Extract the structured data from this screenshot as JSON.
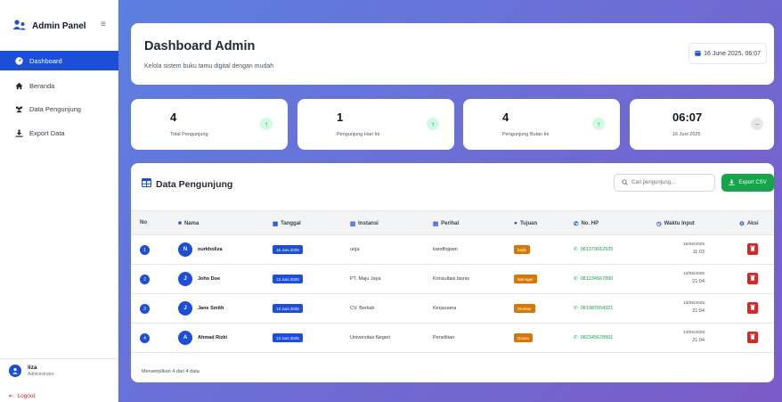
{
  "sidebar": {
    "brand": "Admin Panel",
    "items": [
      {
        "label": "Dashboard",
        "icon": "gauge-icon"
      },
      {
        "label": "Beranda",
        "icon": "home-icon"
      },
      {
        "label": "Data Pengunjung",
        "icon": "users-icon"
      },
      {
        "label": "Export Data",
        "icon": "download-icon"
      }
    ],
    "user": {
      "name": "liza",
      "role": "Administrator"
    },
    "logout_label": "Logout"
  },
  "header": {
    "title": "Dashboard Admin",
    "subtitle": "Kelola sistem buku tamu digital dengan mudah",
    "datetime": "16 June 2025, 06:07"
  },
  "stats": [
    {
      "value": "4",
      "label": "Total Pengunjung",
      "icon": "arrow-up-icon"
    },
    {
      "value": "1",
      "label": "Pengunjung Hari Ini",
      "icon": "arrow-up-icon"
    },
    {
      "value": "4",
      "label": "Pengunjung Bulan Ini",
      "icon": "arrow-up-icon"
    },
    {
      "value": "06:07",
      "label": "16 Juni 2025",
      "icon": "minus-icon"
    }
  ],
  "table": {
    "title": "Data Pengunjung",
    "search_placeholder": "Cari pengunjung...",
    "export_label": "Export CSV",
    "columns": [
      "No",
      "Nama",
      "Tanggal",
      "Instansi",
      "Perihal",
      "Tujuan",
      "No. HP",
      "Waktu Input",
      "Aksi"
    ],
    "rows": [
      {
        "no": "1",
        "initial": "N",
        "nama": "nurkholiza",
        "tanggal": "16 Juni 2025",
        "instansi": "unja",
        "perihal": "kandfojpwn",
        "tujuan": "badir",
        "hp": "081379012925",
        "waktu_date": "16/06/2025",
        "waktu_time": "11:03"
      },
      {
        "no": "2",
        "initial": "J",
        "nama": "John Doe",
        "tanggal": "13 Juni 2025",
        "instansi": "PT. Maju Jaya",
        "perihal": "Konsultasi bisnis",
        "tujuan": "Manager",
        "hp": "081234567890",
        "waktu_date": "13/06/2025",
        "waktu_time": "21:04"
      },
      {
        "no": "3",
        "initial": "J",
        "nama": "Jane Smith",
        "tanggal": "13 Juni 2025",
        "instansi": "CV. Berkah",
        "perihal": "Kerjasama",
        "tujuan": "Direktur",
        "hp": "081987654321",
        "waktu_date": "13/06/2025",
        "waktu_time": "21:04"
      },
      {
        "no": "4",
        "initial": "A",
        "nama": "Ahmad Rizki",
        "tanggal": "13 Juni 2025",
        "instansi": "Universitas Negeri",
        "perihal": "Penelitian",
        "tujuan": "Dosen",
        "hp": "082345678901",
        "waktu_date": "13/06/2025",
        "waktu_time": "21:04"
      }
    ],
    "footer": {
      "prefix": "Menampilkan",
      "shown": "4",
      "mid": "dari",
      "total": "4",
      "suffix": "data"
    }
  },
  "colors": {
    "accent": "#1d4ed8",
    "success": "#16a34a",
    "danger": "#dc2626",
    "warning": "#d97706"
  }
}
